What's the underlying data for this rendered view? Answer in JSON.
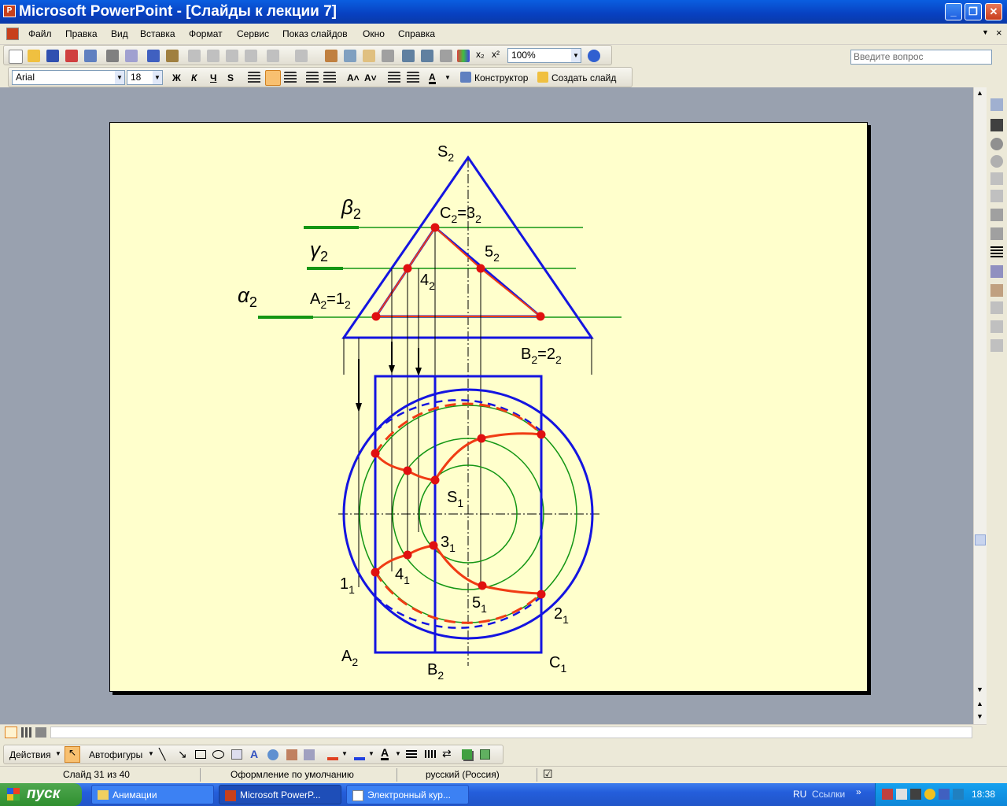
{
  "window": {
    "title": "Microsoft PowerPoint - [Слайды к лекции 7]"
  },
  "menu": {
    "items": [
      "Файл",
      "Правка",
      "Вид",
      "Вставка",
      "Формат",
      "Сервис",
      "Показ слайдов",
      "Окно",
      "Справка"
    ],
    "help_placeholder": "Введите вопрос"
  },
  "toolbar": {
    "zoom": "100%",
    "font_name": "Arial",
    "font_size": "18",
    "bold": "Ж",
    "italic": "К",
    "underline": "Ч",
    "shadow": "S",
    "designer_label": "Конструктор",
    "new_slide_label": "Создать слайд"
  },
  "slide_labels": {
    "s2": "S",
    "s2_sub": "2",
    "beta": "β",
    "beta_sub": "2",
    "gamma": "γ",
    "gamma_sub": "2",
    "alpha": "α",
    "alpha_sub": "2",
    "c2": "C",
    "c2_sub1": "2",
    "c2_mid": "=3",
    "c2_sub2": "2",
    "p5_2": "5",
    "p5_2_sub": "2",
    "p4_2": "4",
    "p4_2_sub": "2",
    "a2eq": "A",
    "a2eq_sub1": "2",
    "a2eq_mid": "=1",
    "a2eq_sub2": "2",
    "b2eq": "B",
    "b2eq_sub1": "2",
    "b2eq_mid": "=2",
    "b2eq_sub2": "2",
    "s1": "S",
    "s1_sub": "1",
    "p3_1": "3",
    "p3_1_sub": "1",
    "p4_1": "4",
    "p4_1_sub": "1",
    "p1_1": "1",
    "p1_1_sub": "1",
    "p5_1": "5",
    "p5_1_sub": "1",
    "p2_1": "2",
    "p2_1_sub": "1",
    "a2": "A",
    "a2_sub": "2",
    "b2": "B",
    "b2_sub": "2",
    "c1": "C",
    "c1_sub": "1"
  },
  "drawing_toolbar": {
    "actions": "Действия",
    "autoshapes": "Автофигуры"
  },
  "status": {
    "slide": "Слайд 31 из 40",
    "design": "Оформление по умолчанию",
    "language": "русский (Россия)"
  },
  "taskbar": {
    "start": "пуск",
    "tasks": [
      "Анимации",
      "Microsoft PowerP...",
      "Электронный кур..."
    ],
    "lang": "RU",
    "links": "Ссылки",
    "clock": "18:38"
  },
  "colors": {
    "blue_lines": "#1414e0",
    "green_lines": "#149614",
    "red_curves": "#f03c14",
    "slide_bg": "#ffffcc"
  }
}
